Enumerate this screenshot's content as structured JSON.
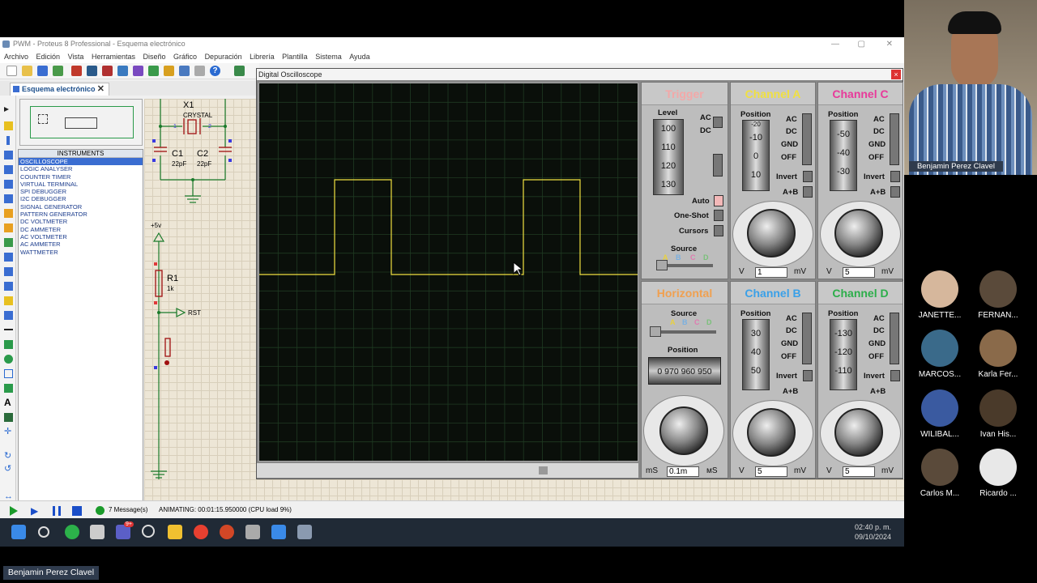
{
  "window": {
    "title": "PWM - Proteus 8 Professional - Esquema electrónico"
  },
  "menu": [
    "Archivo",
    "Edición",
    "Vista",
    "Herramientas",
    "Diseño",
    "Gráfico",
    "Depuración",
    "Librería",
    "Plantilla",
    "Sistema",
    "Ayuda"
  ],
  "tab": {
    "label": "Esquema electrónico"
  },
  "instruments": {
    "header": "INSTRUMENTS",
    "items": [
      "OSCILLOSCOPE",
      "LOGIC ANALYSER",
      "COUNTER TIMER",
      "VIRTUAL TERMINAL",
      "SPI DEBUGGER",
      "I2C DEBUGGER",
      "SIGNAL GENERATOR",
      "PATTERN GENERATOR",
      "DC VOLTMETER",
      "DC AMMETER",
      "AC VOLTMETER",
      "AC AMMETER",
      "WATTMETER"
    ],
    "selected": "OSCILLOSCOPE"
  },
  "schematic": {
    "x1": "X1",
    "crystal": "CRYSTAL",
    "pin1": "1",
    "pin2": "2",
    "c1": "C1",
    "c2": "C2",
    "c1_val": "22pF",
    "c2_val": "22pF",
    "vcc": "+5v",
    "r1": "R1",
    "r1_val": "1k",
    "rst": "RST"
  },
  "oscilloscope": {
    "title": "Digital Oscilloscope",
    "close": "×",
    "waveform_levels": {
      "low_div": 3.5,
      "high_div": 1.2
    },
    "trigger": {
      "title": "Trigger",
      "level_label": "Level",
      "drum": [
        "100",
        "110",
        "120",
        "130"
      ],
      "ac": "AC",
      "dc": "DC",
      "auto": "Auto",
      "oneshot": "One-Shot",
      "cursors": "Cursors",
      "source": "Source",
      "src_letters": [
        "A",
        "B",
        "C",
        "D"
      ]
    },
    "horizontal": {
      "title": "Horizontal",
      "source": "Source",
      "src_letters": [
        "A",
        "B",
        "C",
        "D"
      ],
      "position": "Position",
      "position_readout": "0 970 960 950",
      "value": "0.1m",
      "unit_left": "mS",
      "unit_right": "мS"
    },
    "channel_a": {
      "title": "Channel A",
      "position": "Position",
      "drum": [
        "-20",
        "-10",
        "0",
        "10"
      ],
      "ac": "AC",
      "dc": "DC",
      "gnd": "GND",
      "off": "OFF",
      "invert": "Invert",
      "apb": "A+B",
      "value": "1",
      "unit_left": "V",
      "unit_right": "mV",
      "color": "#f0e040"
    },
    "channel_b": {
      "title": "Channel B",
      "position": "Position",
      "drum": [
        "30",
        "40",
        "50"
      ],
      "ac": "AC",
      "dc": "DC",
      "gnd": "GND",
      "off": "OFF",
      "invert": "Invert",
      "apb": "A+B",
      "value": "5",
      "unit_left": "V",
      "unit_right": "mV",
      "color": "#3aa0e8"
    },
    "channel_c": {
      "title": "Channel C",
      "position": "Position",
      "drum": [
        "-50",
        "-40",
        "-30"
      ],
      "ac": "AC",
      "dc": "DC",
      "gnd": "GND",
      "off": "OFF",
      "invert": "Invert",
      "apb": "A+B",
      "value": "5",
      "unit_left": "V",
      "unit_right": "mV",
      "color": "#e83a9a"
    },
    "channel_d": {
      "title": "Channel D",
      "position": "Position",
      "drum": [
        "-130",
        "-120",
        "-110"
      ],
      "ac": "AC",
      "dc": "DC",
      "gnd": "GND",
      "off": "OFF",
      "invert": "Invert",
      "apb": "A+B",
      "value": "5",
      "unit_left": "V",
      "unit_right": "mV",
      "color": "#2cae4a"
    }
  },
  "status": {
    "messages": "7 Message(s)",
    "animating": "ANIMATING: 00:01:15.950000 (CPU load 9%)"
  },
  "taskbar": {
    "time": "02:40 p. m.",
    "date": "09/10/2024",
    "badge": "9+"
  },
  "meeting": {
    "host": "Benjamin Perez Clavel",
    "participants": [
      "JANETTE...",
      "FERNAN...",
      "MARCOS...",
      "Karla Fer...",
      "WILIBAL...",
      "Ivan His...",
      "Carlos M...",
      "Ricardo ..."
    ],
    "self_name": "Benjamin Perez Clavel"
  }
}
